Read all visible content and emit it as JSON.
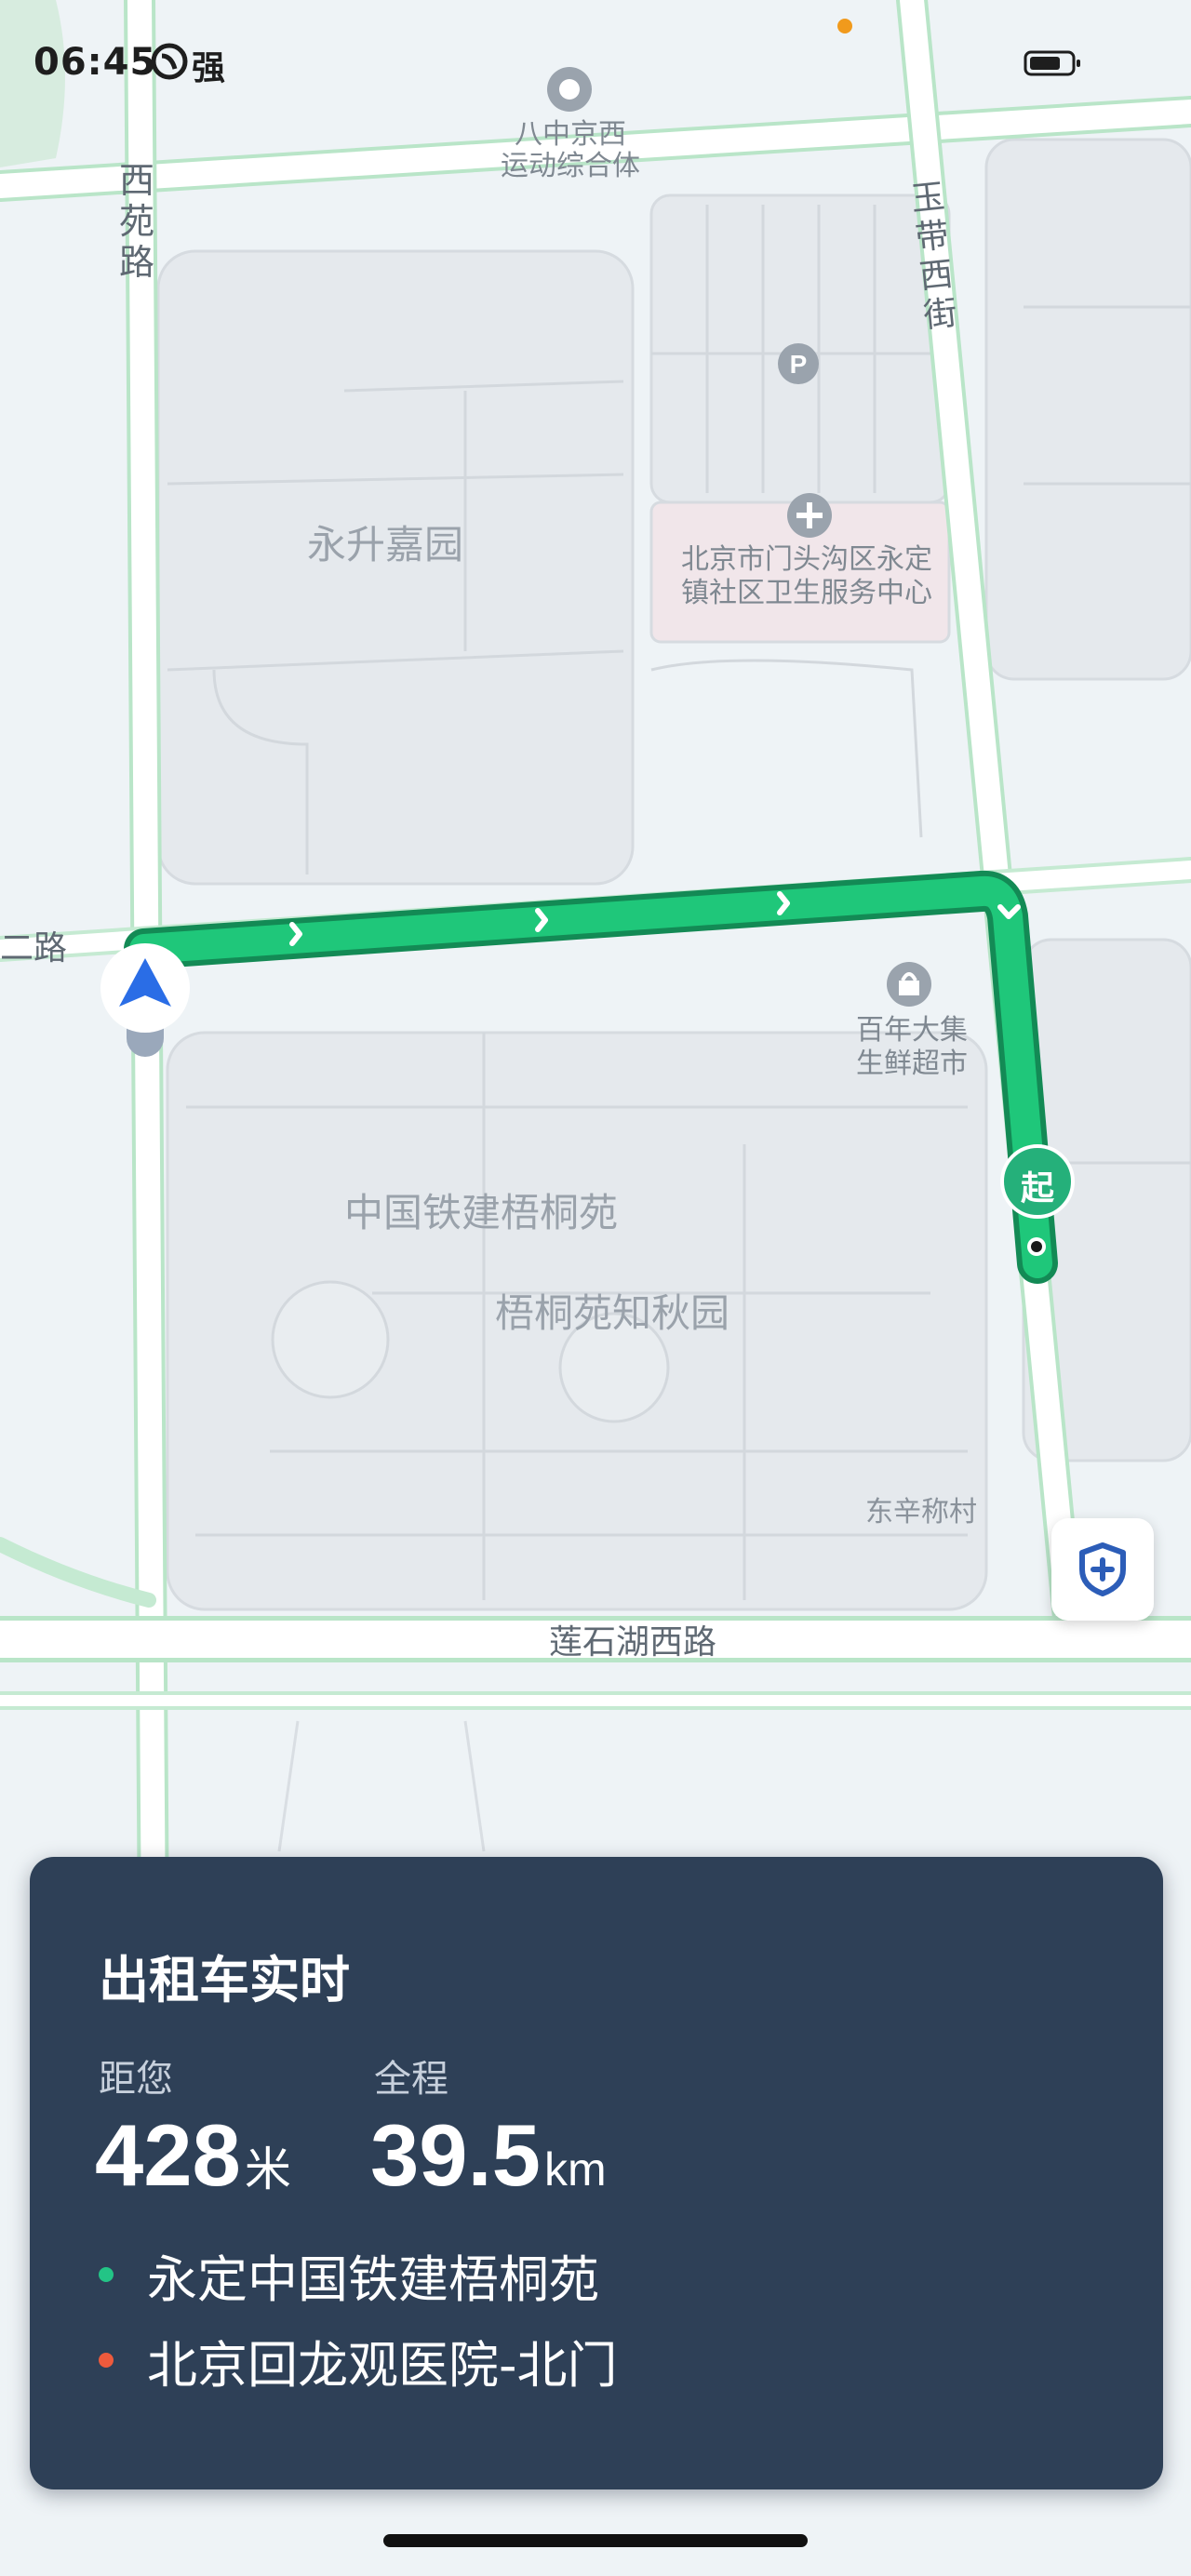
{
  "status_bar": {
    "time": "06:45",
    "carrier": "强",
    "signal_icon": "signal-icon",
    "battery_icon": "battery-icon"
  },
  "map": {
    "roads": {
      "xiyuan_road": "西苑路",
      "yudai_west_street": "玉带西街",
      "second_road_fragment": "二路",
      "lianshihu_west_road": "莲石湖西路"
    },
    "pois": {
      "sports_complex": [
        "八中京西",
        "运动综合体"
      ],
      "yongsheng_garden": "永升嘉园",
      "health_center": [
        "北京市门头沟区永定",
        "镇社区卫生服务中心"
      ],
      "supermarket": [
        "百年大集",
        "生鲜超市"
      ],
      "crcc_wutongyuan": "中国铁建梧桐苑",
      "wutongyuan_zhiqiu": "梧桐苑知秋园",
      "dongxin_village": "东辛称村"
    },
    "start_marker_label": "起",
    "route_color": "#1fc77a",
    "route_border_color": "#138a55"
  },
  "card": {
    "title": "出租车实时",
    "distance_label": "距您",
    "distance_value": "428",
    "distance_unit": "米",
    "total_label": "全程",
    "total_value": "39.5",
    "total_unit": "km",
    "origin": "永定中国铁建梧桐苑",
    "destination": "北京回龙观医院-北门",
    "origin_dot_color": "#23c486",
    "destination_dot_color": "#ee5a3c"
  }
}
